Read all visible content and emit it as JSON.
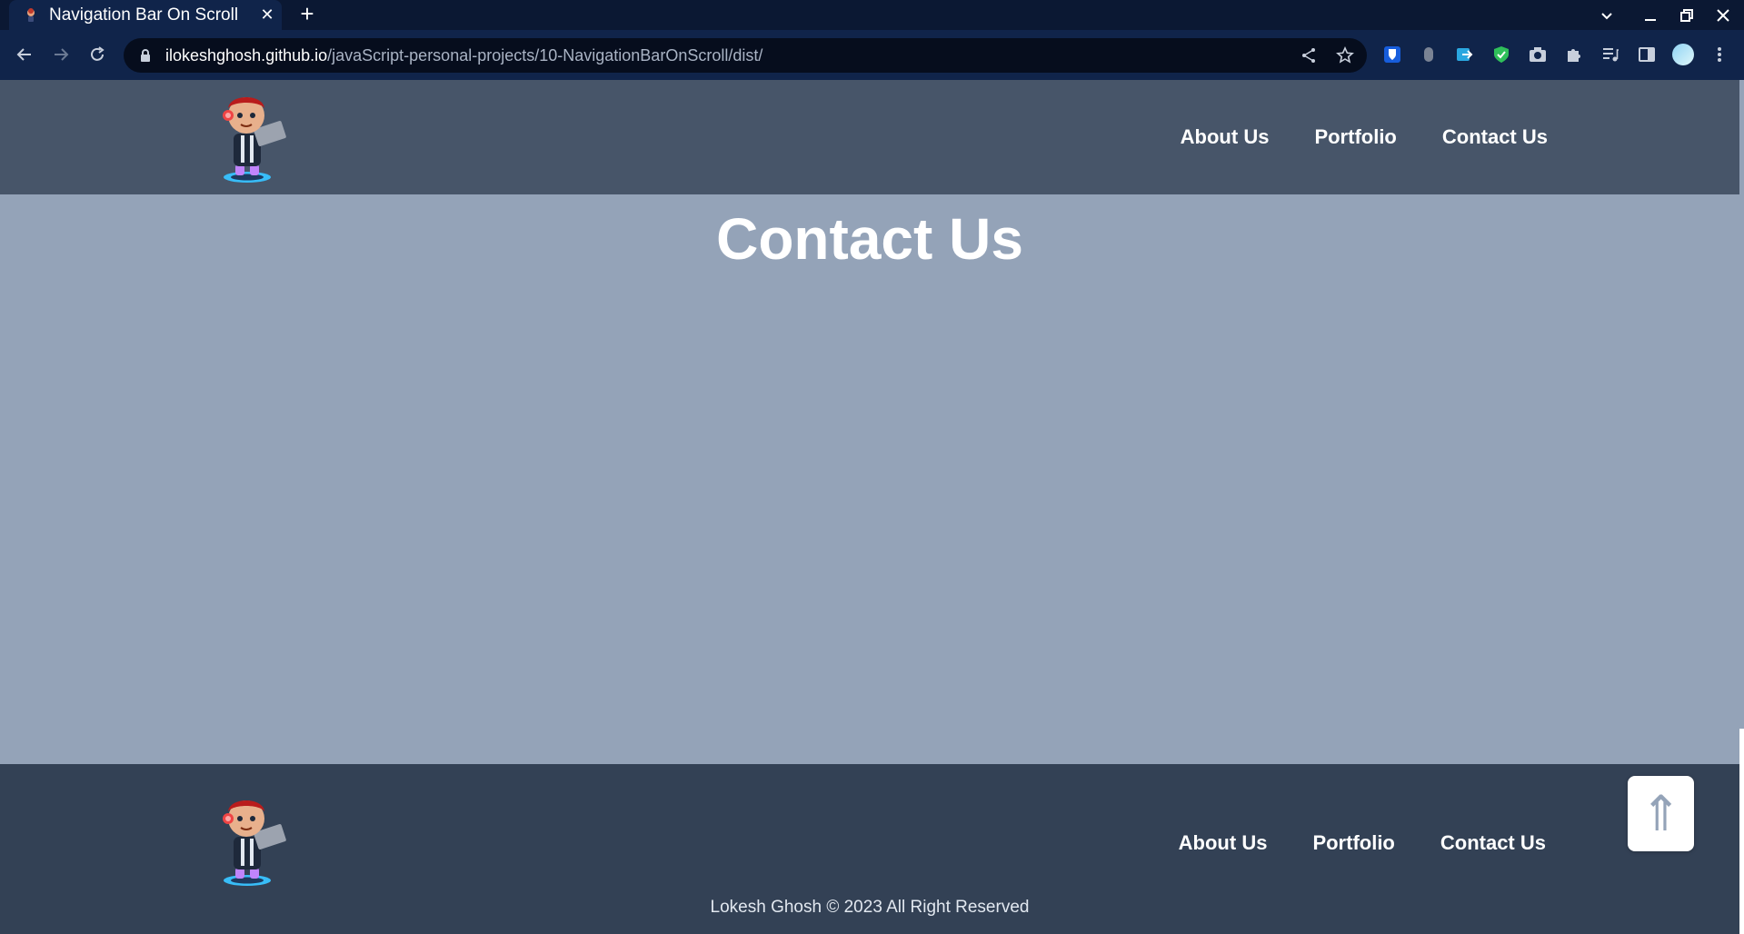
{
  "browser": {
    "tab_title": "Navigation Bar On Scroll",
    "tab_close": "✕",
    "new_tab": "+",
    "url_host": "ilokeshghosh.github.io",
    "url_path": "/javaScript-personal-projects/10-NavigationBarOnScroll/dist/",
    "window_controls": {
      "tabs_menu": "⌄",
      "minimize": "–",
      "restore": "❐",
      "close": "✕"
    },
    "icons": [
      "back-icon",
      "forward-icon",
      "reload-icon",
      "lock-icon",
      "share-icon",
      "star-icon",
      "bitwarden-icon",
      "mouse-icon",
      "translate-icon",
      "shield-icon",
      "camera-icon",
      "puzzle-icon",
      "media-queue-icon",
      "side-panel-icon",
      "profile-avatar",
      "more-icon"
    ]
  },
  "header": {
    "nav": [
      {
        "label": "About Us"
      },
      {
        "label": "Portfolio"
      },
      {
        "label": "Contact Us"
      }
    ]
  },
  "main": {
    "title": "Contact Us"
  },
  "footer": {
    "nav": [
      {
        "label": "About Us"
      },
      {
        "label": "Portfolio"
      },
      {
        "label": "Contact Us"
      }
    ],
    "copyright": "Lokesh Ghosh © 2023 All Right Reserved"
  },
  "back_to_top": {
    "label": "⇑"
  },
  "colors": {
    "browser_frame": "#0b1833",
    "browser_toolbar": "#10244a",
    "header_bg": "#475569",
    "main_bg": "#94a3b8",
    "footer_bg": "#334155",
    "nav_text": "#ffffff"
  }
}
